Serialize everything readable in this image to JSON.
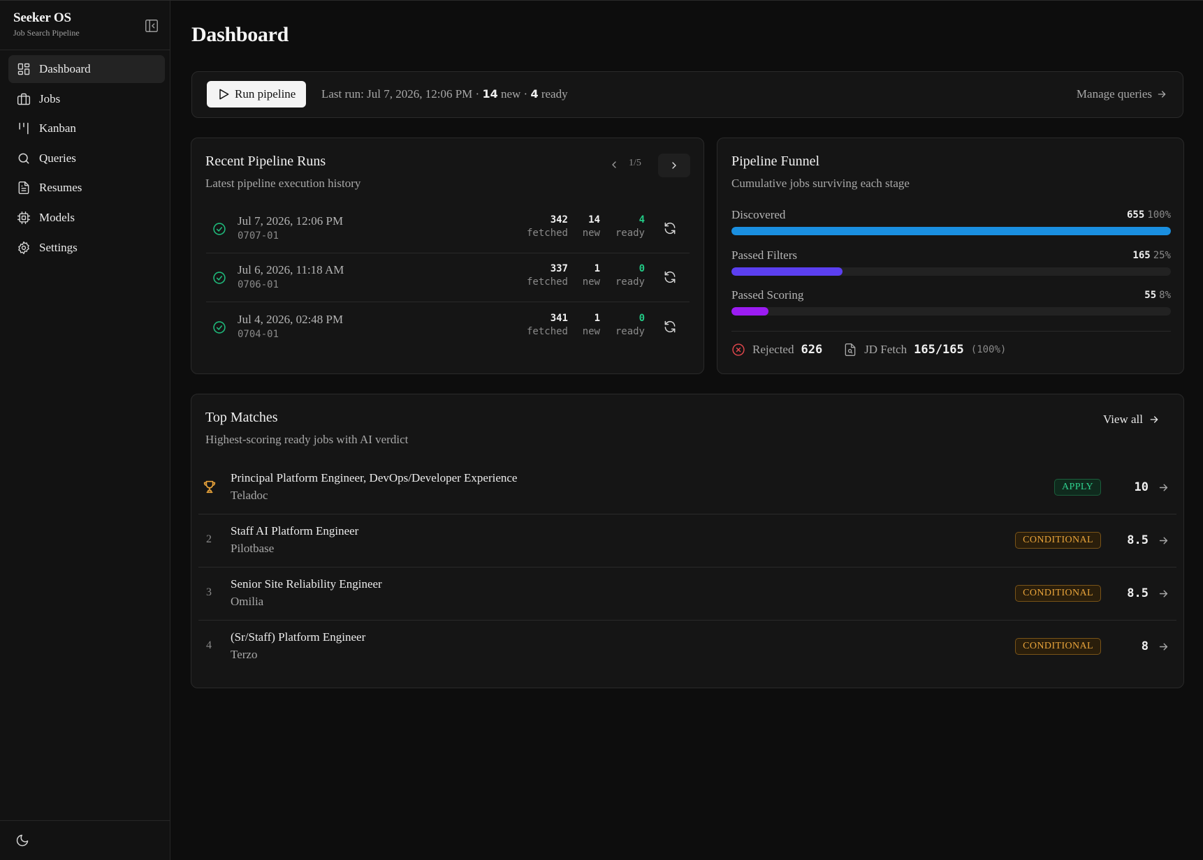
{
  "app": {
    "title": "Seeker OS",
    "subtitle": "Job Search Pipeline"
  },
  "sidebar": {
    "items": [
      {
        "label": "Dashboard",
        "icon": "dashboard-icon",
        "active": true
      },
      {
        "label": "Jobs",
        "icon": "briefcase-icon",
        "active": false
      },
      {
        "label": "Kanban",
        "icon": "kanban-icon",
        "active": false
      },
      {
        "label": "Queries",
        "icon": "search-icon",
        "active": false
      },
      {
        "label": "Resumes",
        "icon": "document-icon",
        "active": false
      },
      {
        "label": "Models",
        "icon": "cpu-icon",
        "active": false
      },
      {
        "label": "Settings",
        "icon": "gear-icon",
        "active": false
      }
    ]
  },
  "page": {
    "title": "Dashboard"
  },
  "runbar": {
    "run_button": "Run pipeline",
    "last_run_prefix": "Last run: Jul 7, 2026, 12:06 PM ·",
    "new_count": "14",
    "new_label": "new ·",
    "ready_count": "4",
    "ready_label": "ready",
    "manage_link": "Manage queries"
  },
  "runs": {
    "title": "Recent Pipeline Runs",
    "subtitle": "Latest pipeline execution history",
    "pager": "1/5",
    "rows": [
      {
        "date": "Jul 7, 2026, 12:06 PM",
        "id": "0707-01",
        "fetched": "342",
        "new": "14",
        "ready": "4"
      },
      {
        "date": "Jul 6, 2026, 11:18 AM",
        "id": "0706-01",
        "fetched": "337",
        "new": "1",
        "ready": "0"
      },
      {
        "date": "Jul 4, 2026, 02:48 PM",
        "id": "0704-01",
        "fetched": "341",
        "new": "1",
        "ready": "0"
      }
    ],
    "labels": {
      "fetched": "fetched",
      "new": "new",
      "ready": "ready"
    }
  },
  "funnel": {
    "title": "Pipeline Funnel",
    "subtitle": "Cumulative jobs surviving each stage",
    "stages": [
      {
        "name": "Discovered",
        "count": "655",
        "pct": "100%",
        "fraction": 1.0,
        "color": "#1a8fe0"
      },
      {
        "name": "Passed Filters",
        "count": "165",
        "pct": "25%",
        "fraction": 0.252,
        "color": "#5b3ff0"
      },
      {
        "name": "Passed Scoring",
        "count": "55",
        "pct": "8%",
        "fraction": 0.084,
        "color": "#9b1cf2"
      }
    ],
    "rejected_label": "Rejected",
    "rejected_count": "626",
    "jd_label": "JD Fetch",
    "jd_value": "165/165",
    "jd_pct": "(100%)"
  },
  "matches": {
    "title": "Top Matches",
    "subtitle": "Highest-scoring ready jobs with AI verdict",
    "view_all": "View all",
    "rows": [
      {
        "rank": "",
        "title": "Principal Platform Engineer, DevOps/Developer Experience",
        "company": "Teladoc",
        "verdict": "APPLY",
        "score": "10"
      },
      {
        "rank": "2",
        "title": "Staff AI Platform Engineer",
        "company": "Pilotbase",
        "verdict": "CONDITIONAL",
        "score": "8.5"
      },
      {
        "rank": "3",
        "title": "Senior Site Reliability Engineer",
        "company": "Omilia",
        "verdict": "CONDITIONAL",
        "score": "8.5"
      },
      {
        "rank": "4",
        "title": "(Sr/Staff) Platform Engineer",
        "company": "Terzo",
        "verdict": "CONDITIONAL",
        "score": "8"
      }
    ]
  }
}
